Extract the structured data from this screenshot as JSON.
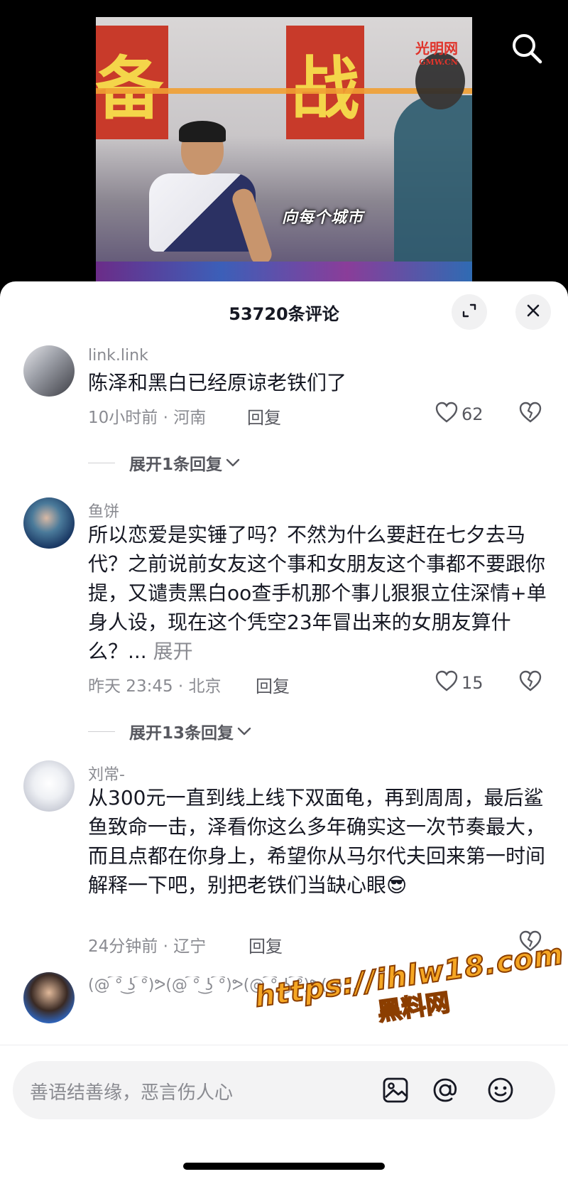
{
  "video": {
    "banner_left": "备",
    "banner_right": "战",
    "logo": "光明网",
    "logo_sub": "GMW.CN",
    "subtitle": "向每个城市"
  },
  "header": {
    "comment_count": "53720条评论"
  },
  "comments": [
    {
      "user": "link.link",
      "text": "陈泽和黑白已经原谅老铁们了",
      "meta": "10小时前 · 河南",
      "reply": "回复",
      "likes": "62",
      "expand": "展开1条回复"
    },
    {
      "user": "鱼饼",
      "text": "所以恋爱是实锤了吗？不然为什么要赶在七夕去马代？之前说前女友这个事和女朋友这个事都不要跟你提，又谴责黑白oo查手机那个事儿狠狠立住深情+单身人设，现在这个凭空23年冒出来的女朋友算什么？...",
      "more": " 展开",
      "meta": "昨天 23:45 · 北京",
      "reply": "回复",
      "likes": "15",
      "expand": "展开13条回复"
    },
    {
      "user": "刘常-",
      "text": "从300元一直到线上线下双面龟，再到周周，最后鲨鱼致命一击，泽看你这么多年确实这一次节奏最大，而且点都在你身上，希望你从马尔代夫回来第一时间解释一下吧，别把老铁们当缺心眼😎",
      "meta": "24分钟前 · 辽宁",
      "reply": "回复"
    },
    {
      "user": "(@ ͡° ͜ʖ ͡°)ᕗ(@ ͡° ͜ʖ ͡°)ᕗ(@ ͡° ͜ʖ ͡°)ᕗ(@..."
    }
  ],
  "composer": {
    "placeholder": "善语结善缘，恶言伤人心"
  },
  "watermark": {
    "url": "https://ihlw18.com",
    "name": "黑料网"
  },
  "icons": [
    "search-icon",
    "expand-icon",
    "close-icon",
    "heart-icon",
    "dislike-icon",
    "chevron-down-icon",
    "image-icon",
    "at-icon",
    "emoji-icon"
  ]
}
